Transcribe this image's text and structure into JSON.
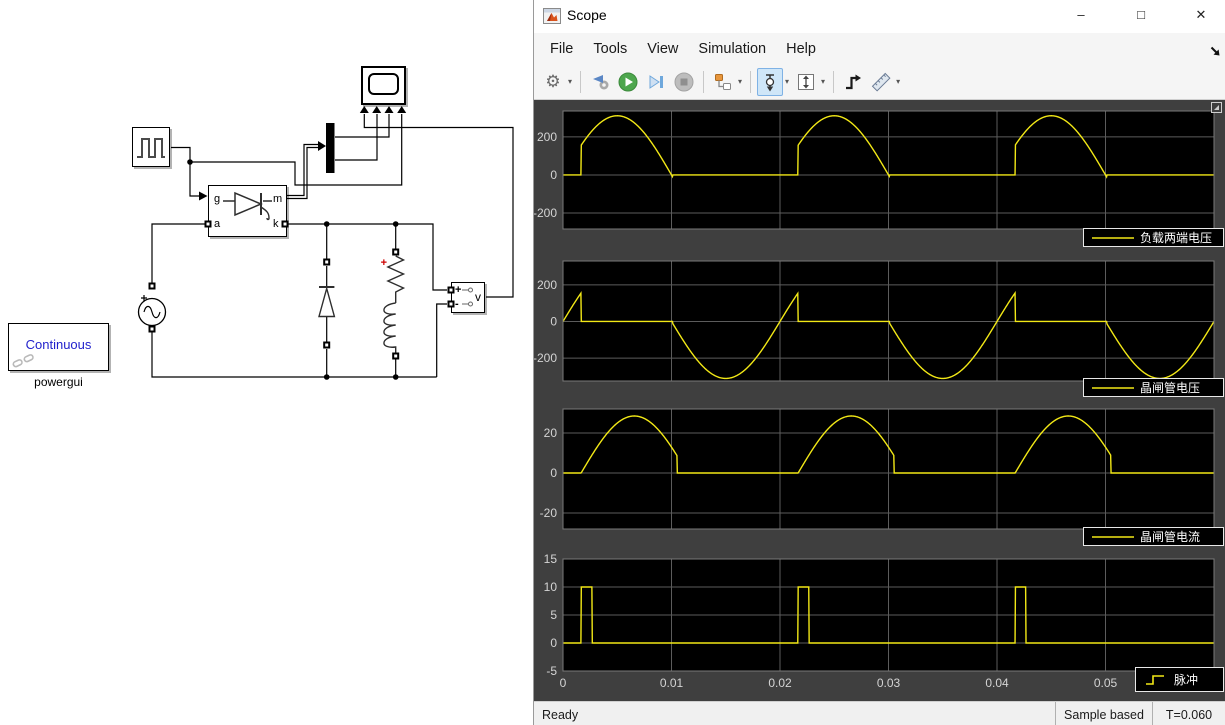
{
  "window": {
    "title": "Scope",
    "controls": [
      "–",
      "□",
      "✕"
    ]
  },
  "menu": {
    "items": [
      "File",
      "Tools",
      "View",
      "Simulation",
      "Help"
    ]
  },
  "toolbar": {
    "icons": [
      "settings-gear",
      "highlight-simulink-block",
      "run",
      "step-forward",
      "stop",
      "configure-signals",
      "cursor-measurements",
      "span-xy",
      "trigger",
      "measurements"
    ]
  },
  "status_bar": {
    "left": "Ready",
    "cells": [
      "Sample based",
      "T=0.060"
    ]
  },
  "model": {
    "thyristor": {
      "g": "g",
      "a": "a",
      "m": "m",
      "k": "k"
    },
    "voltage_measurement": {
      "plus": "+",
      "minus": "-",
      "label": "v"
    },
    "powergui": {
      "mode": "Continuous",
      "label": "powergui"
    },
    "rl_branch_polarity": "+"
  },
  "colors": {
    "trace_yellow": "#f2e816",
    "plot_bg": "#000000",
    "plot_grid": "#5c5c5c",
    "plot_border": "#7a7a7a",
    "tick_text": "#d4d4d4",
    "region_bg": "#3f3f3f",
    "powergui_text": "#2222cc",
    "polarity_red": "#cc0000"
  },
  "chart_data": [
    {
      "type": "line",
      "legend": "负载两端电压",
      "legend_position": "bottom-right",
      "xlim": [
        0,
        0.06
      ],
      "xtick_values": [
        0,
        0.01,
        0.02,
        0.03,
        0.04,
        0.05
      ],
      "xticks": [
        "0",
        "0.01",
        "0.02",
        "0.03",
        "0.04",
        "0.05"
      ],
      "show_x_tick_labels": false,
      "ylim": [
        -284,
        336
      ],
      "yticks": [
        200,
        0,
        -200
      ],
      "grid": true,
      "waveform": {
        "kind": "scr_load_voltage",
        "Vm": 311,
        "freq_hz": 50,
        "period_s": 0.02,
        "firing_time_s": 0.00167,
        "extinction_time_s": 0.0101
      }
    },
    {
      "type": "line",
      "legend": "晶闸管电压",
      "legend_position": "bottom-right",
      "xlim": [
        0,
        0.06
      ],
      "xtick_values": [
        0,
        0.01,
        0.02,
        0.03,
        0.04,
        0.05
      ],
      "xticks": [
        "0",
        "0.01",
        "0.02",
        "0.03",
        "0.04",
        "0.05"
      ],
      "show_x_tick_labels": false,
      "ylim": [
        -325,
        330
      ],
      "yticks": [
        200,
        0,
        -200
      ],
      "grid": true,
      "waveform": {
        "kind": "scr_thyristor_voltage",
        "Vm": 311,
        "freq_hz": 50,
        "period_s": 0.02,
        "firing_time_s": 0.00167,
        "extinction_time_s": 0.0101
      }
    },
    {
      "type": "line",
      "legend": "晶闸管电流",
      "legend_position": "bottom-right",
      "xlim": [
        0,
        0.06
      ],
      "xtick_values": [
        0,
        0.01,
        0.02,
        0.03,
        0.04,
        0.05
      ],
      "xticks": [
        "0",
        "0.01",
        "0.02",
        "0.03",
        "0.04",
        "0.05"
      ],
      "show_x_tick_labels": false,
      "ylim": [
        -28,
        32
      ],
      "yticks": [
        20,
        0,
        -20
      ],
      "grid": true,
      "waveform": {
        "kind": "scr_thyristor_current",
        "Im": 28.5,
        "period_s": 0.02,
        "firing_time_s": 0.00167,
        "extinction_time_s": 0.0105,
        "half_sine_T_s": 0.0098
      }
    },
    {
      "type": "line",
      "legend": "脉冲",
      "legend_icon": "step",
      "legend_position": "bottom-right",
      "xlim": [
        0,
        0.06
      ],
      "xtick_values": [
        0,
        0.01,
        0.02,
        0.03,
        0.04,
        0.05
      ],
      "xticks": [
        "0",
        "0.01",
        "0.02",
        "0.03",
        "0.04",
        "0.05"
      ],
      "show_x_tick_labels": true,
      "ylim": [
        -5,
        15
      ],
      "yticks": [
        15,
        10,
        5,
        0,
        -5
      ],
      "grid": true,
      "waveform": {
        "kind": "gate_pulse",
        "amp": 10,
        "start_s": 0.00167,
        "width_s": 0.001,
        "period_s": 0.02
      }
    }
  ]
}
